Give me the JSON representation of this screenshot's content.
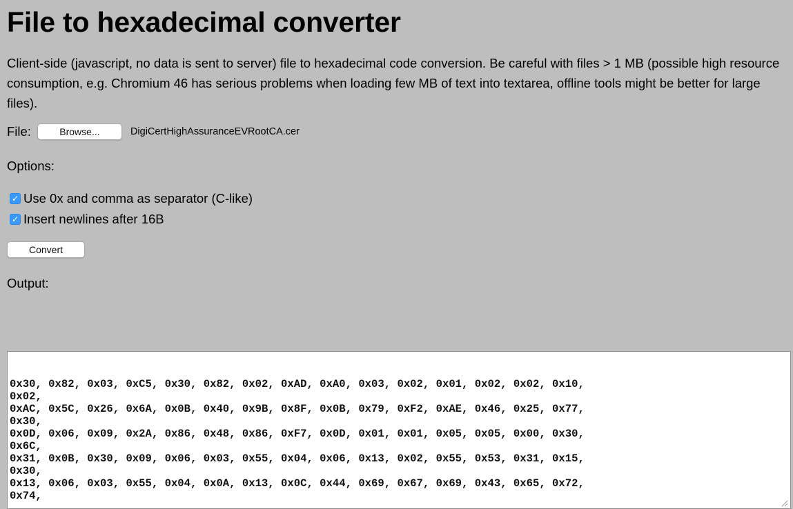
{
  "title": "File to hexadecimal converter",
  "description": "Client-side (javascript, no data is sent to server) file to hexadecimal code conversion. Be careful with files > 1 MB (possible high resource consumption, e.g. Chromium 46 has serious problems when loading few MB of text into textarea, offline tools might be better for large files).",
  "file": {
    "label": "File:",
    "browse_label": "Browse...",
    "selected_file": "DigiCertHighAssuranceEVRootCA.cer"
  },
  "options": {
    "label": "Options:",
    "items": [
      {
        "label": "Use 0x and comma as separator (C-like)",
        "checked": true
      },
      {
        "label": "Insert newlines after 16B",
        "checked": true
      }
    ]
  },
  "convert_label": "Convert",
  "output": {
    "label": "Output:",
    "text": "0x30, 0x82, 0x03, 0xC5, 0x30, 0x82, 0x02, 0xAD, 0xA0, 0x03, 0x02, 0x01, 0x02, 0x02, 0x10,\n0x02,\n0xAC, 0x5C, 0x26, 0x6A, 0x0B, 0x40, 0x9B, 0x8F, 0x0B, 0x79, 0xF2, 0xAE, 0x46, 0x25, 0x77,\n0x30,\n0x0D, 0x06, 0x09, 0x2A, 0x86, 0x48, 0x86, 0xF7, 0x0D, 0x01, 0x01, 0x05, 0x05, 0x00, 0x30,\n0x6C,\n0x31, 0x0B, 0x30, 0x09, 0x06, 0x03, 0x55, 0x04, 0x06, 0x13, 0x02, 0x55, 0x53, 0x31, 0x15,\n0x30,\n0x13, 0x06, 0x03, 0x55, 0x04, 0x0A, 0x13, 0x0C, 0x44, 0x69, 0x67, 0x69, 0x43, 0x65, 0x72,\n0x74,"
  },
  "colors": {
    "background": "#bebebe",
    "checkbox": "#3b99fc"
  }
}
